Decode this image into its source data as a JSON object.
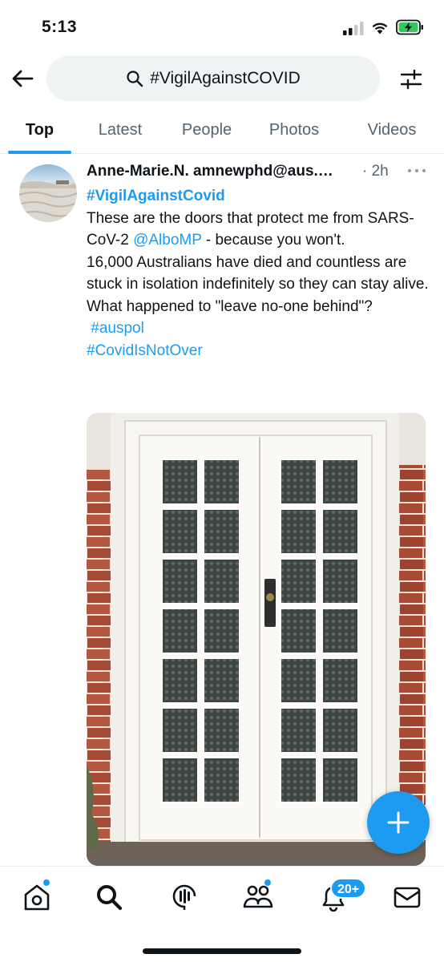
{
  "status_bar": {
    "time": "5:13",
    "icons": [
      "signal-icon",
      "wifi-icon",
      "battery-charging-icon"
    ]
  },
  "search": {
    "query": "#VigilAgainstCOVID",
    "icons": [
      "back-arrow-icon",
      "search-icon",
      "filter-sliders-icon"
    ]
  },
  "tabs": [
    {
      "label": "Top",
      "active": true
    },
    {
      "label": "Latest",
      "active": false
    },
    {
      "label": "People",
      "active": false
    },
    {
      "label": "Photos",
      "active": false
    },
    {
      "label": "Videos",
      "active": false
    }
  ],
  "tweet": {
    "author_name": "Anne-Marie.N.",
    "author_handle": "amnewphd@aus.…",
    "time": "· 2h",
    "hashtag_top": "#VigilAgainstCovid",
    "text_1": "These are the doors that protect me from SARS-CoV-2 ",
    "mention": "@AlboMP",
    "text_2": " - because you won't.",
    "text_3": "16,000 Australians have died and countless are stuck in isolation indefinitely so they can stay alive.",
    "text_4": "What happened to \"leave no-one behind\"?",
    "hashtag_1": "#auspol",
    "hashtag_2": "#CovidIsNotOver",
    "image": "photo of white french doors with textured glass panes between red brick walls"
  },
  "compose_button": {
    "icon": "plus-icon"
  },
  "bottom_nav": {
    "items": [
      "home-icon",
      "search-icon",
      "spaces-icon",
      "communities-icon",
      "notifications-icon",
      "messages-icon"
    ],
    "notification_badge": "20+"
  },
  "colors": {
    "accent": "#1d9bf0",
    "text": "#0f1419",
    "secondary_text": "#536471",
    "search_bg": "#eff3f4"
  }
}
